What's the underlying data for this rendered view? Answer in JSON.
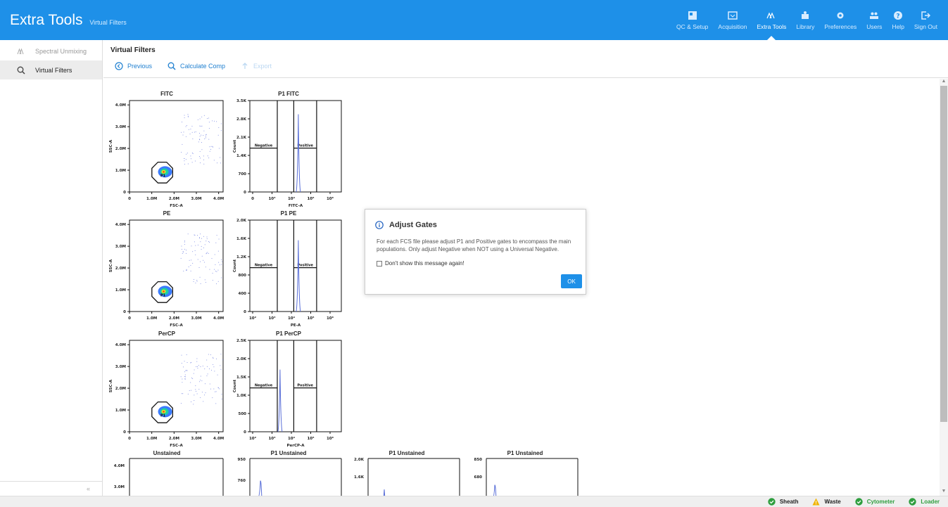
{
  "app": {
    "title": "Extra Tools",
    "subtitle": "Virtual Filters"
  },
  "nav": [
    {
      "label": "QC & Setup",
      "icon": "qc-setup-icon"
    },
    {
      "label": "Acquisition",
      "icon": "acquisition-icon"
    },
    {
      "label": "Extra Tools",
      "icon": "extra-tools-icon"
    },
    {
      "label": "Library",
      "icon": "library-icon"
    },
    {
      "label": "Preferences",
      "icon": "gear-icon"
    },
    {
      "label": "Users",
      "icon": "users-icon"
    },
    {
      "label": "Help",
      "icon": "help-icon"
    },
    {
      "label": "Sign Out",
      "icon": "sign-out-icon"
    }
  ],
  "sidebar": {
    "items": [
      {
        "label": "Spectral Unmixing",
        "icon": "spectral-unmixing-icon"
      },
      {
        "label": "Virtual Filters",
        "icon": "virtual-filters-icon"
      }
    ],
    "collapse": "«"
  },
  "page": {
    "title": "Virtual Filters"
  },
  "toolbar": {
    "previous": "Previous",
    "calculate": "Calculate Comp",
    "export": "Export"
  },
  "dialog": {
    "title": "Adjust Gates",
    "message": "For each FCS file please adjust P1 and Positive gates to encompass the main populations. Only adjust Negative when NOT using a Universal Negative.",
    "checkbox": "Don't show this message again!",
    "ok": "OK"
  },
  "status": [
    {
      "label": "Sheath",
      "color": "#2e9e3e",
      "icon": "check-circle-icon"
    },
    {
      "label": "Waste",
      "color": "#f0b400",
      "icon": "warning-icon"
    },
    {
      "label": "Cytometer",
      "color": "#2e9e3e",
      "icon": "check-circle-icon"
    },
    {
      "label": "Loader",
      "color": "#2e9e3e",
      "icon": "check-circle-icon"
    }
  ],
  "colors": {
    "accent": "#1e90e8",
    "gate": "#111111"
  },
  "scatter_axes": {
    "x_label": "FSC-A",
    "y_label": "SSC-A",
    "x_ticks": [
      "0",
      "1.0M",
      "2.0M",
      "3.0M",
      "4.0M"
    ],
    "y_ticks": [
      "0",
      "1.0M",
      "2.0M",
      "3.0M",
      "4.0M"
    ],
    "gate_label": "P1"
  },
  "histogram": {
    "y_label": "Count",
    "negative_label": "Negative",
    "positive_label": "Positive"
  },
  "chart_data": [
    {
      "type": "scatter",
      "title": "FITC",
      "xlabel": "FSC-A",
      "ylabel": "SSC-A",
      "xlim": [
        0,
        4.2
      ],
      "ylim": [
        0,
        4.2
      ],
      "gate": "P1"
    },
    {
      "type": "histogram",
      "title": "P1 FITC",
      "xlabel": "FITC-A",
      "ylabel": "Count",
      "y_ticks": [
        "0",
        "700",
        "1.4K",
        "2.1K",
        "2.8K",
        "3.5K"
      ],
      "x_ticks": [
        "0",
        "10³",
        "10⁴",
        "10⁵",
        "10⁶"
      ]
    },
    {
      "type": "scatter",
      "title": "PE",
      "xlabel": "FSC-A",
      "ylabel": "SSC-A",
      "xlim": [
        0,
        4.2
      ],
      "ylim": [
        0,
        4.2
      ],
      "gate": "P1"
    },
    {
      "type": "histogram",
      "title": "P1 PE",
      "xlabel": "PE-A",
      "ylabel": "Count",
      "y_ticks": [
        "0",
        "400",
        "800",
        "1.2K",
        "1.6K",
        "2.0K"
      ],
      "x_ticks": [
        "10²",
        "10³",
        "10⁴",
        "10⁵",
        "10⁶"
      ]
    },
    {
      "type": "scatter",
      "title": "PerCP",
      "xlabel": "FSC-A",
      "ylabel": "SSC-A",
      "xlim": [
        0,
        4.2
      ],
      "ylim": [
        0,
        4.2
      ],
      "gate": "P1"
    },
    {
      "type": "histogram",
      "title": "P1 PerCP",
      "xlabel": "PerCP-A",
      "ylabel": "Count",
      "y_ticks": [
        "0",
        "500",
        "1.0K",
        "1.5K",
        "2.0K",
        "2.5K"
      ],
      "x_ticks": [
        "10²",
        "10³",
        "10⁴",
        "10⁵",
        "10⁶"
      ]
    },
    {
      "type": "scatter",
      "title": "Unstained",
      "ylabel": "SSC-A",
      "y_ticks": [
        "3.0M",
        "4.0M"
      ]
    },
    {
      "type": "histogram",
      "title": "P1 Unstained",
      "y_ticks": [
        "760",
        "950"
      ]
    },
    {
      "type": "histogram",
      "title": "P1 Unstained",
      "y_ticks": [
        "1.6K",
        "2.0K"
      ]
    },
    {
      "type": "histogram",
      "title": "P1 Unstained",
      "y_ticks": [
        "680",
        "850"
      ]
    }
  ]
}
